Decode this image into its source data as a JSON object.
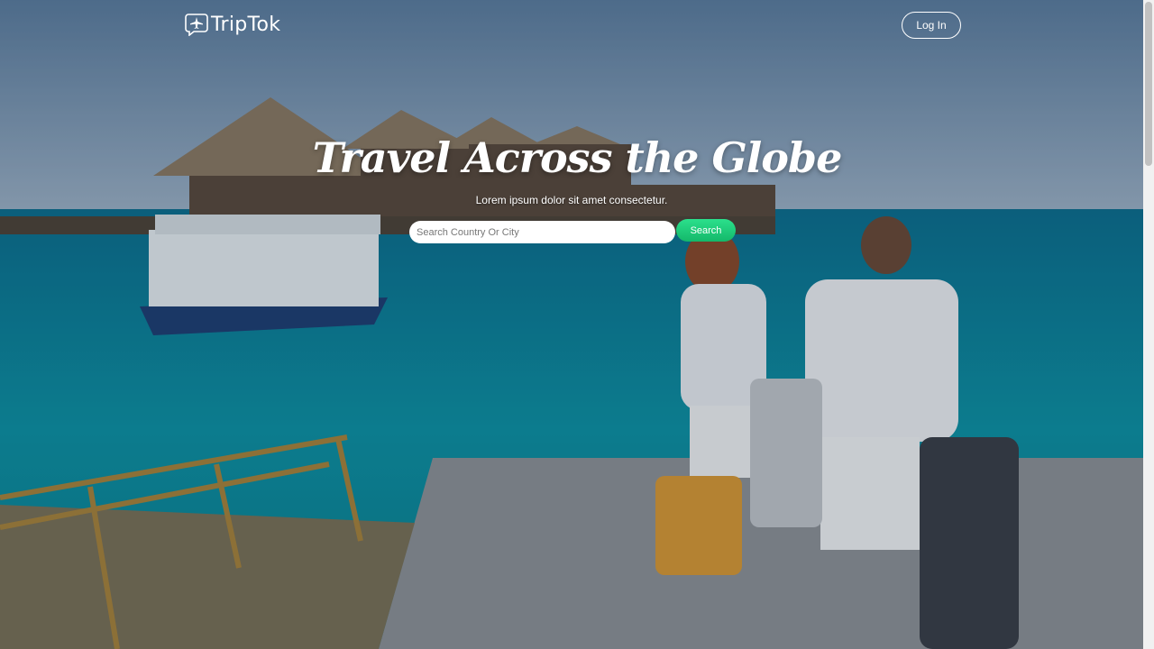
{
  "brand": {
    "name": "TripTok",
    "logo_icon": "plane-chat-icon"
  },
  "nav": {
    "login_label": "Log In"
  },
  "hero": {
    "title": "Travel Across the Globe",
    "subtitle": "Lorem ipsum dolor sit amet consectetur."
  },
  "search": {
    "placeholder": "Search Country Or City",
    "value": "",
    "button_label": "Search"
  },
  "colors": {
    "search_button": "#1fcf7e",
    "text": "#ffffff"
  }
}
